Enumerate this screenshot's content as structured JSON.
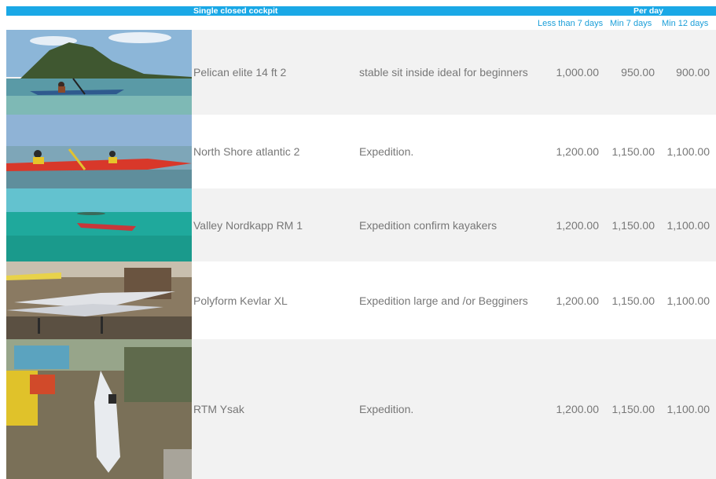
{
  "header": {
    "title": "Single closed cockpit",
    "per_day": "Per day",
    "sub_less7": "Less than 7 days",
    "sub_min7": "Min 7 days",
    "sub_min12": "Min 12 days"
  },
  "colors": {
    "accent": "#1aa8e6",
    "row_alt": "#f2f2f2",
    "text": "#777777"
  },
  "rows": [
    {
      "name": "Pelican elite 14 ft  2",
      "desc": "stable sit inside ideal for beginners",
      "p1": "1,000.00",
      "p2": "950.00",
      "p3": "900.00"
    },
    {
      "name": "North Shore atlantic 2",
      "desc": "Expedition.",
      "p1": "1,200.00",
      "p2": "1,150.00",
      "p3": "1,100.00"
    },
    {
      "name": "Valley Nordkapp RM   1",
      "desc": "Expedition confirm kayakers",
      "p1": "1,200.00",
      "p2": "1,150.00",
      "p3": "1,100.00"
    },
    {
      "name": "Polyform Kevlar XL",
      "desc": "Expedition large and /or Begginers",
      "p1": "1,200.00",
      "p2": "1,150.00",
      "p3": "1,100.00"
    },
    {
      "name": "RTM Ysak",
      "desc": "Expedition.",
      "p1": "1,200.00",
      "p2": "1,150.00",
      "p3": "1,100.00"
    }
  ]
}
